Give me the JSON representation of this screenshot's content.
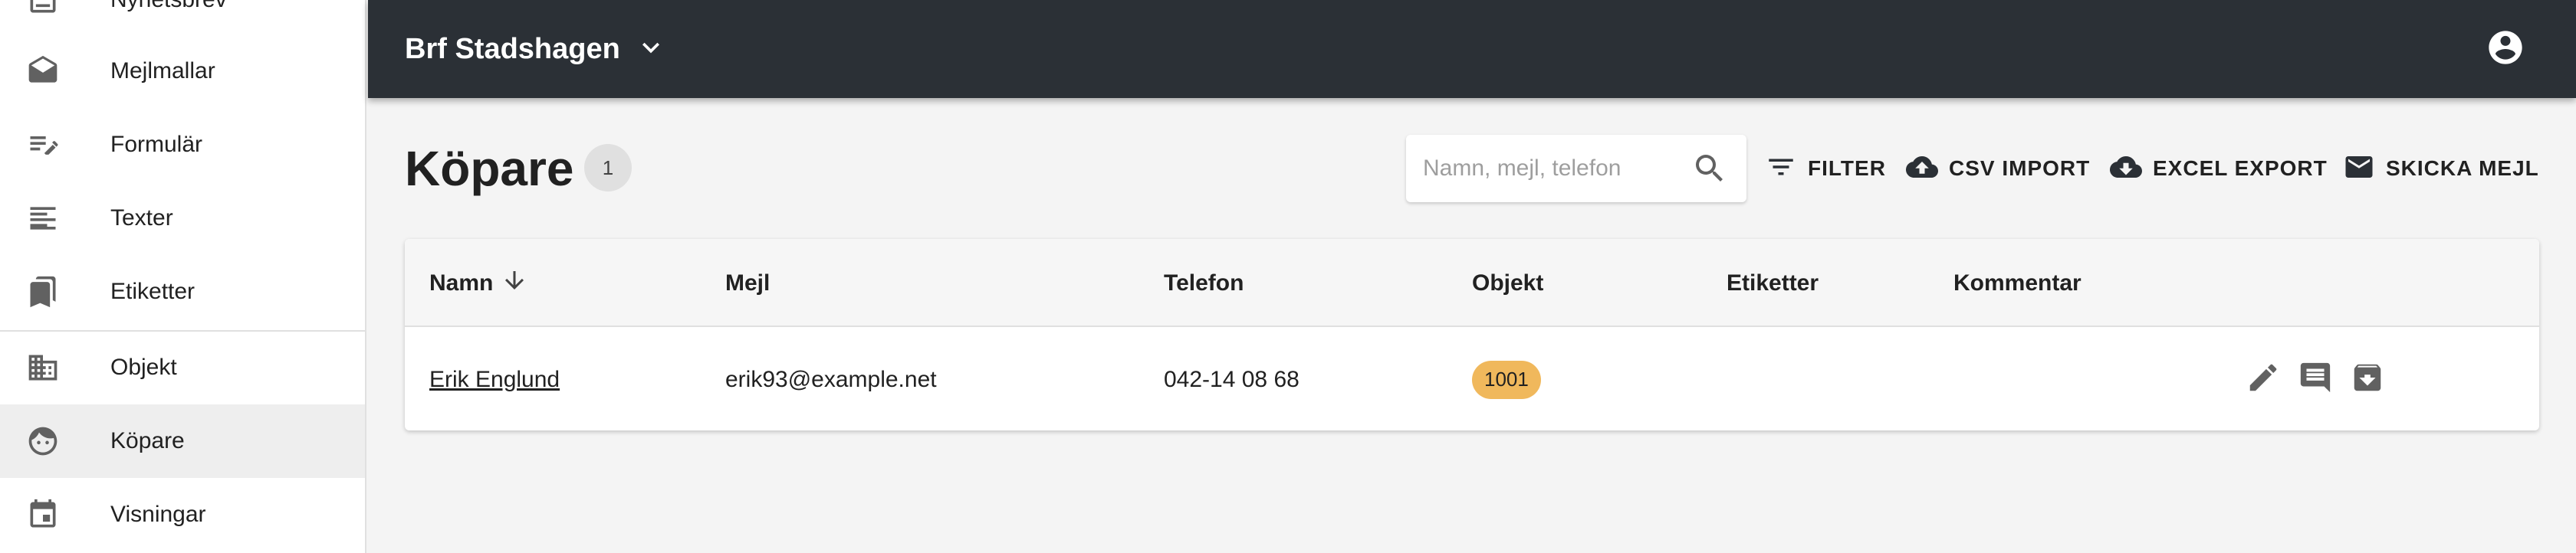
{
  "sidebar": {
    "items": [
      {
        "label": "Nyhetsbrev",
        "icon": "newsletter-icon",
        "active": false
      },
      {
        "label": "Mejlmallar",
        "icon": "drafts-icon",
        "active": false
      },
      {
        "label": "Formulär",
        "icon": "edit-note-icon",
        "active": false
      },
      {
        "label": "Texter",
        "icon": "text-lines-icon",
        "active": false
      },
      {
        "label": "Etiketter",
        "icon": "bookmarks-icon",
        "active": false
      },
      {
        "label": "Objekt",
        "icon": "building-icon",
        "active": false
      },
      {
        "label": "Köpare",
        "icon": "face-icon",
        "active": true
      },
      {
        "label": "Visningar",
        "icon": "calendar-icon",
        "active": false
      }
    ]
  },
  "appbar": {
    "org_name": "Brf Stadshagen",
    "icons": {
      "org_menu": "chevron-down-icon",
      "account": "account-circle-icon"
    }
  },
  "page": {
    "title": "Köpare",
    "count": "1"
  },
  "search": {
    "placeholder": "Namn, mejl, telefon",
    "value": ""
  },
  "actions": {
    "filter": "FILTER",
    "csv_import": "CSV IMPORT",
    "excel_export": "EXCEL EXPORT",
    "send_mail": "SKICKA MEJL"
  },
  "table": {
    "columns": {
      "name": "Namn",
      "email": "Mejl",
      "phone": "Telefon",
      "object": "Objekt",
      "tags": "Etiketter",
      "comment": "Kommentar"
    },
    "sort": {
      "column": "name",
      "direction": "descending-arrow"
    },
    "rows": [
      {
        "name": "Erik Englund",
        "email": "erik93@example.net",
        "phone": "042-14 08 68",
        "object": "1001",
        "tags": "",
        "comment": ""
      }
    ],
    "row_actions": [
      "edit-icon",
      "comment-icon",
      "archive-icon"
    ]
  },
  "colors": {
    "appbar": "#2b3036",
    "background": "#f4f4f4",
    "object_badge": "#f0b85c",
    "active_nav": "#eeeeee"
  }
}
